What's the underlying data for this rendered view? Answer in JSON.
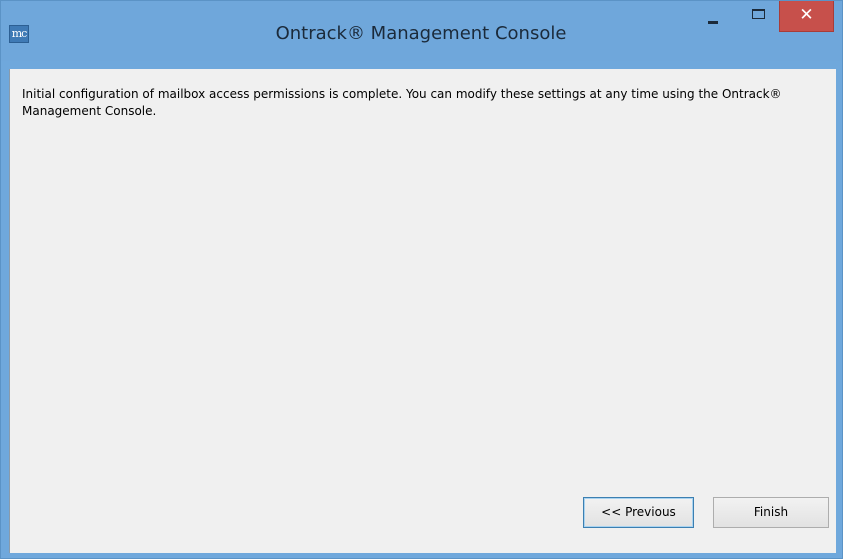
{
  "window": {
    "title": "Ontrack® Management Console",
    "app_icon_text": "mc",
    "controls": {
      "minimize_icon": "minimize-icon",
      "maximize_icon": "maximize-icon",
      "close_glyph": "✕"
    }
  },
  "content": {
    "message": "Initial configuration of mailbox access permissions is complete. You can modify these settings at any time using the Ontrack® Management Console."
  },
  "buttons": {
    "previous_label": "<< Previous",
    "finish_label": "Finish"
  },
  "colors": {
    "titlebar": "#6fa7db",
    "close_button": "#c7504b",
    "client_background": "#f0f0f0"
  }
}
